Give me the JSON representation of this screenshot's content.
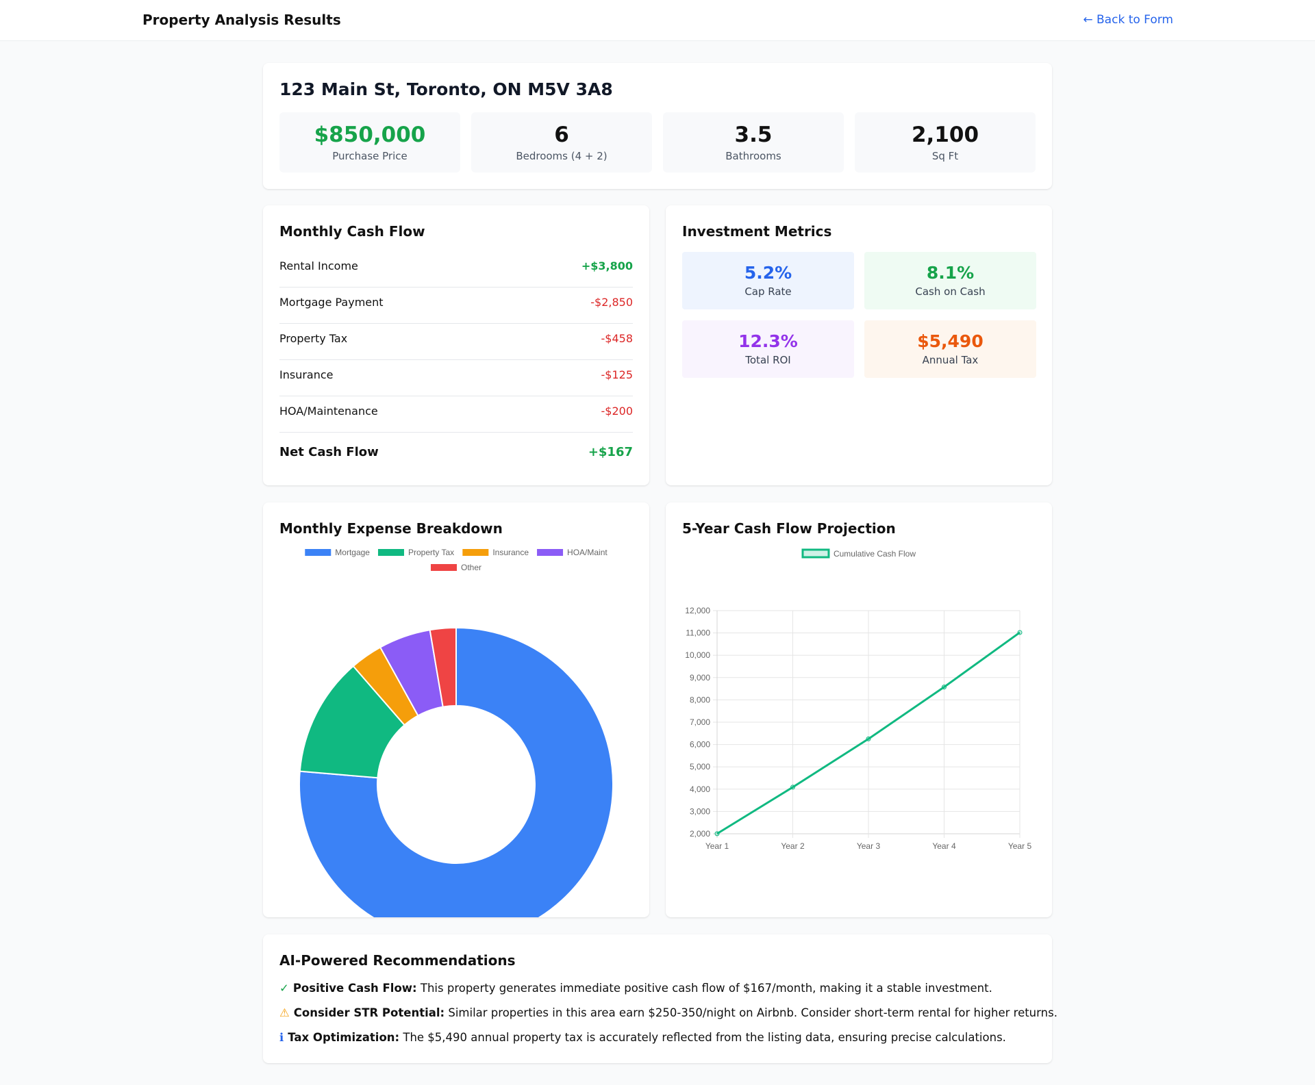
{
  "header": {
    "title": "Property Analysis Results",
    "back_label": "← Back to Form"
  },
  "property": {
    "address": "123 Main St, Toronto, ON M5V 3A8",
    "stats": [
      {
        "value": "$850,000",
        "label": "Purchase Price",
        "color": "#16a34a"
      },
      {
        "value": "6",
        "label": "Bedrooms (4 + 2)",
        "color": "#111111"
      },
      {
        "value": "3.5",
        "label": "Bathrooms",
        "color": "#111111"
      },
      {
        "value": "2,100",
        "label": "Sq Ft",
        "color": "#111111"
      }
    ]
  },
  "cash_flow": {
    "title": "Monthly Cash Flow",
    "rows": [
      {
        "label": "Rental Income",
        "value": "+$3,800"
      },
      {
        "label": "Mortgage Payment",
        "value": "-$2,850"
      },
      {
        "label": "Property Tax",
        "value": "-$458"
      },
      {
        "label": "Insurance",
        "value": "-$125"
      },
      {
        "label": "HOA/Maintenance",
        "value": "-$200"
      }
    ],
    "net": {
      "label": "Net Cash Flow",
      "value": "+$167"
    }
  },
  "metrics": {
    "title": "Investment Metrics",
    "items": [
      {
        "value": "5.2%",
        "label": "Cap Rate",
        "color": "#2563eb",
        "bg": "#eef4fe"
      },
      {
        "value": "8.1%",
        "label": "Cash on Cash",
        "color": "#16a34a",
        "bg": "#effbf3"
      },
      {
        "value": "12.3%",
        "label": "Total ROI",
        "color": "#9333ea",
        "bg": "#f9f4fe"
      },
      {
        "value": "$5,490",
        "label": "Annual Tax",
        "color": "#ea580c",
        "bg": "#fef6ee"
      }
    ]
  },
  "expense_chart": {
    "title": "Monthly Expense Breakdown"
  },
  "projection_chart": {
    "title": "5-Year Cash Flow Projection"
  },
  "chart_data": [
    {
      "type": "pie",
      "variant": "doughnut",
      "categories": [
        "Mortgage",
        "Property Tax",
        "Insurance",
        "HOA/Maint",
        "Other"
      ],
      "values": [
        2850,
        458,
        125,
        200,
        100
      ],
      "colors": [
        "#3b82f6",
        "#10b981",
        "#f59e0b",
        "#8b5cf6",
        "#ef4444"
      ],
      "legend": "top"
    },
    {
      "type": "line",
      "categories": [
        "Year 1",
        "Year 2",
        "Year 3",
        "Year 4",
        "Year 5"
      ],
      "series": [
        {
          "name": "Cumulative Cash Flow",
          "values": [
            2004,
            4088,
            6252,
            8576,
            11020
          ],
          "color": "#10b981"
        }
      ],
      "ylim": [
        2000,
        12000
      ],
      "yticks": [
        "2,000",
        "3,000",
        "4,000",
        "5,000",
        "6,000",
        "7,000",
        "8,000",
        "9,000",
        "10,000",
        "11,000",
        "12,000"
      ],
      "grid": true,
      "legend": "top"
    }
  ],
  "recommendations": {
    "title": "AI-Powered Recommendations",
    "items": [
      {
        "icon": "✓",
        "icon_color": "#16a34a",
        "bold": "Positive Cash Flow:",
        "text": " This property generates immediate positive cash flow of $167/month, making it a stable investment."
      },
      {
        "icon": "⚠",
        "icon_color": "#f59e0b",
        "bold": "Consider STR Potential:",
        "text": " Similar properties in this area earn $250-350/night on Airbnb. Consider short-term rental for higher returns."
      },
      {
        "icon": "ℹ",
        "icon_color": "#2563eb",
        "bold": "Tax Optimization:",
        "text": " The $5,490 annual property tax is accurately reflected from the listing data, ensuring precise calculations."
      }
    ]
  }
}
